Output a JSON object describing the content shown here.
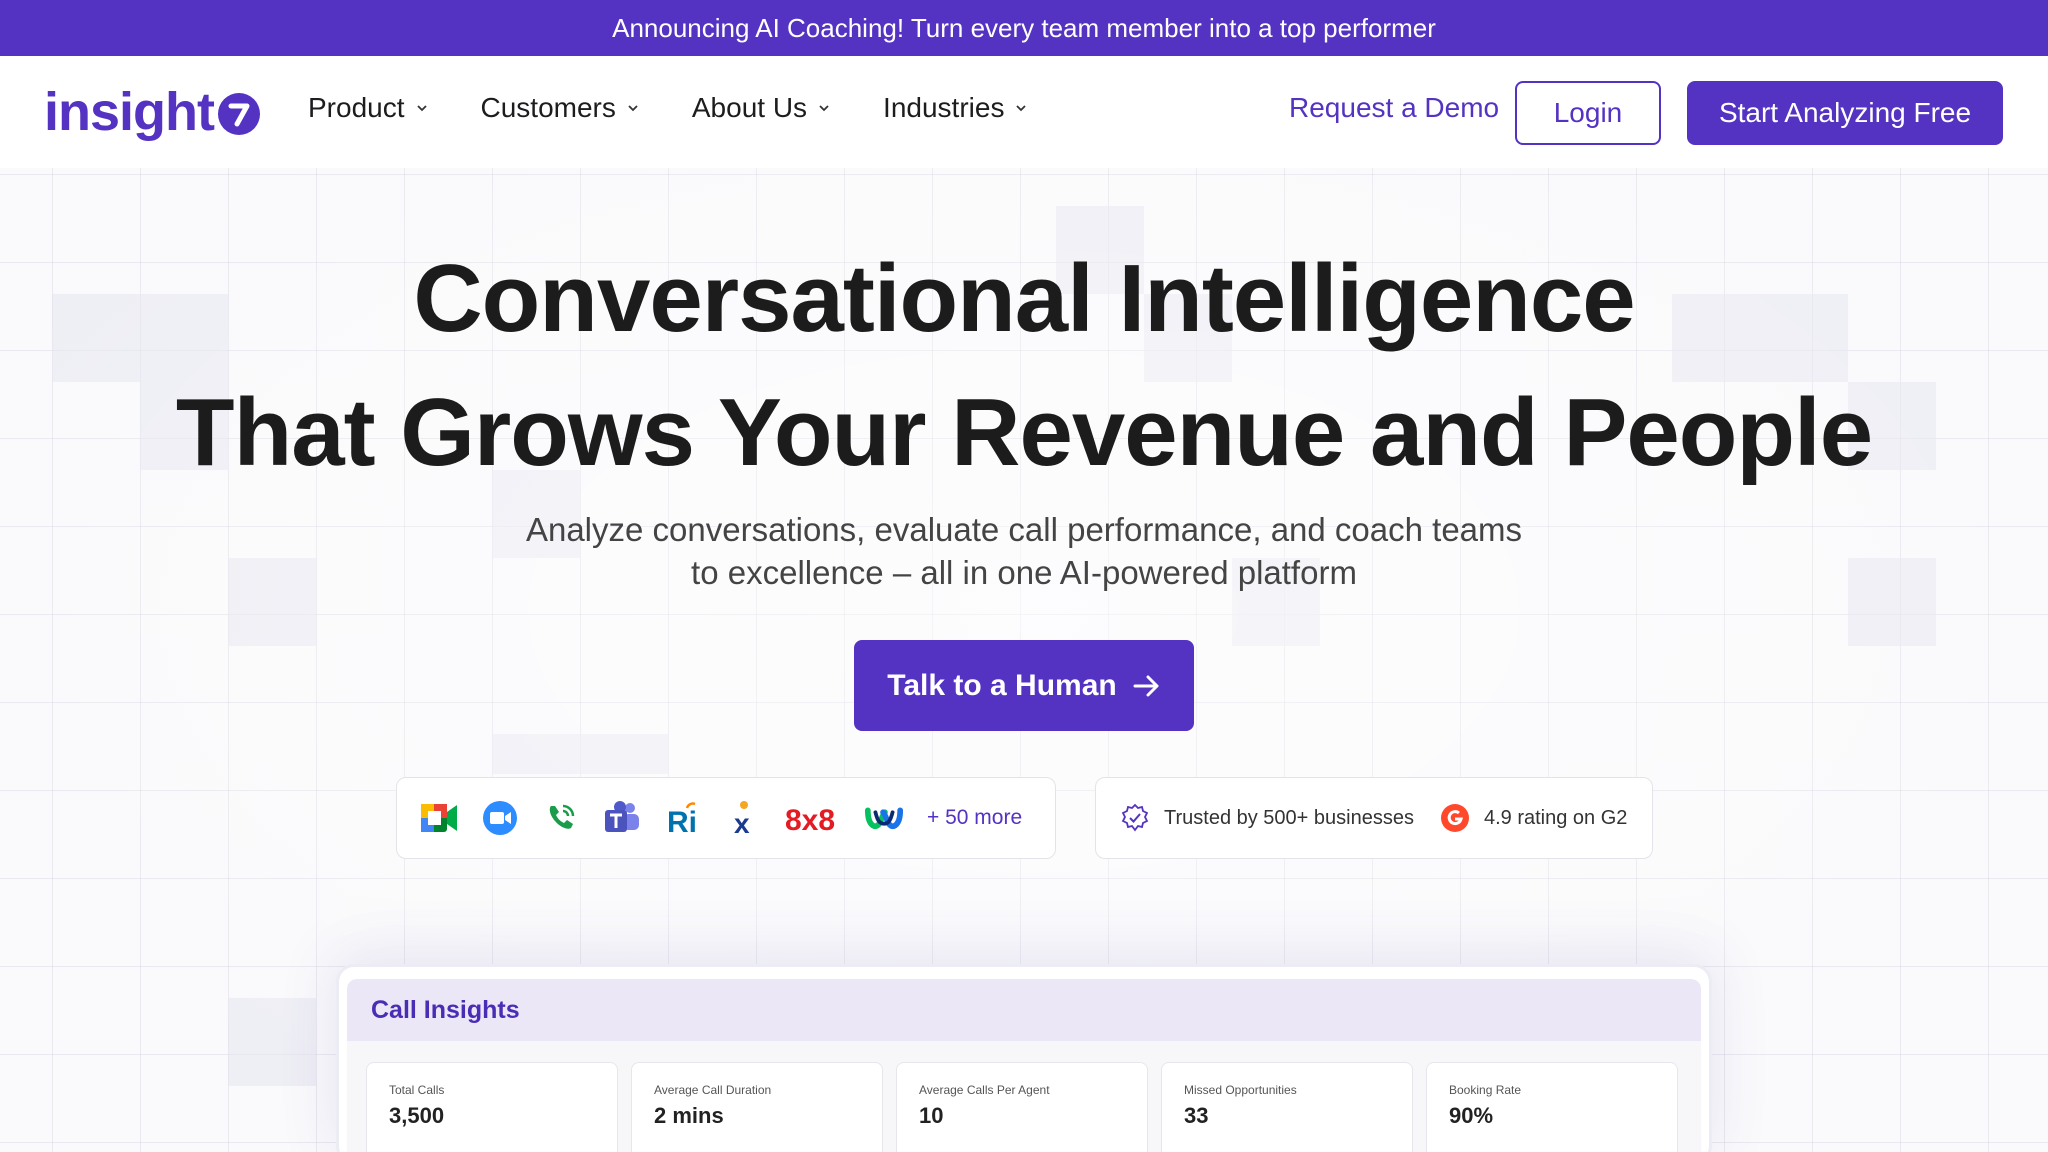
{
  "announcement": "Announcing AI Coaching! Turn every team member into a top performer",
  "brand": {
    "logo_text": "insight",
    "logo_badge": "7",
    "accent": "#5432c2"
  },
  "nav": {
    "items": [
      {
        "label": "Product"
      },
      {
        "label": "Customers"
      },
      {
        "label": "About Us"
      },
      {
        "label": "Industries"
      }
    ],
    "request_demo": "Request a Demo",
    "login": "Login",
    "start": "Start Analyzing Free"
  },
  "hero": {
    "title_line1": "Conversational Intelligence",
    "title_line2": "That Grows Your Revenue and People",
    "subtitle_line1": "Analyze conversations, evaluate call performance, and coach teams",
    "subtitle_line2": "to excellence – all in one AI-powered platform",
    "cta": "Talk to a Human"
  },
  "integrations": {
    "icons": [
      "google-meet-icon",
      "zoom-icon",
      "phone-icon",
      "microsoft-teams-icon",
      "ringcentral-icon",
      "xcally-icon",
      "8x8-icon",
      "webex-icon"
    ],
    "ri_text": "Ri",
    "x_text": "x",
    "eight_text": "8x8",
    "more": "+ 50 more"
  },
  "trust": {
    "businesses": "Trusted by 500+ businesses",
    "rating": "4.9 rating on G2"
  },
  "dashboard": {
    "title": "Call Insights",
    "stats": [
      {
        "label": "Total Calls",
        "value": "3,500"
      },
      {
        "label": "Average Call Duration",
        "value": "2 mins"
      },
      {
        "label": "Average Calls Per Agent",
        "value": "10"
      },
      {
        "label": "Missed Opportunities",
        "value": "33"
      },
      {
        "label": "Booking Rate",
        "value": "90%"
      }
    ]
  }
}
